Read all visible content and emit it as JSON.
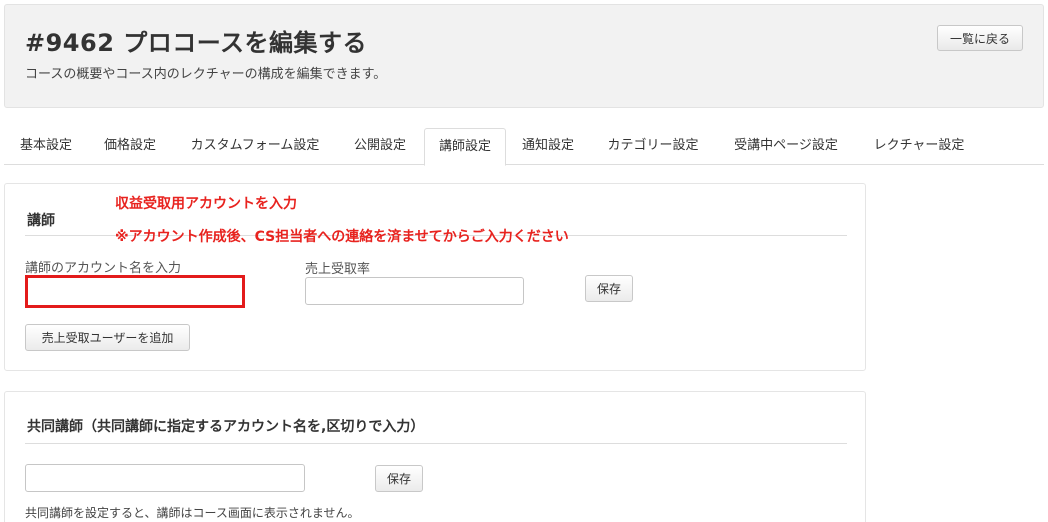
{
  "header": {
    "title": "#9462 プロコースを編集する",
    "subtitle": "コースの概要やコース内のレクチャーの構成を編集できます。",
    "back_label": "一覧に戻る"
  },
  "tabs": [
    {
      "label": "基本設定",
      "active": false
    },
    {
      "label": "価格設定",
      "active": false
    },
    {
      "label": "カスタムフォーム設定",
      "active": false
    },
    {
      "label": "公開設定",
      "active": false
    },
    {
      "label": "講師設定",
      "active": true
    },
    {
      "label": "通知設定",
      "active": false
    },
    {
      "label": "カテゴリー設定",
      "active": false
    },
    {
      "label": "受講中ページ設定",
      "active": false
    },
    {
      "label": "レクチャー設定",
      "active": false
    }
  ],
  "instructor_panel": {
    "heading": "講師",
    "annotation_line1": "収益受取用アカウントを入力",
    "annotation_line2": "※アカウント作成後、CS担当者への連絡を済ませてからご入力ください",
    "account_label": "講師のアカウント名を入力",
    "account_value": "",
    "rate_label": "売上受取率",
    "rate_value": "",
    "save_label": "保存",
    "add_user_label": "売上受取ユーザーを追加"
  },
  "co_instructor_panel": {
    "heading": "共同講師（共同講師に指定するアカウント名を,区切りで入力）",
    "input_value": "",
    "save_label": "保存",
    "note": "共同講師を設定すると、講師はコース画面に表示されません。"
  },
  "colors": {
    "annotation": "#e8231f",
    "highlight_border": "#e31b1b",
    "header_bg": "#f2f2f2"
  }
}
